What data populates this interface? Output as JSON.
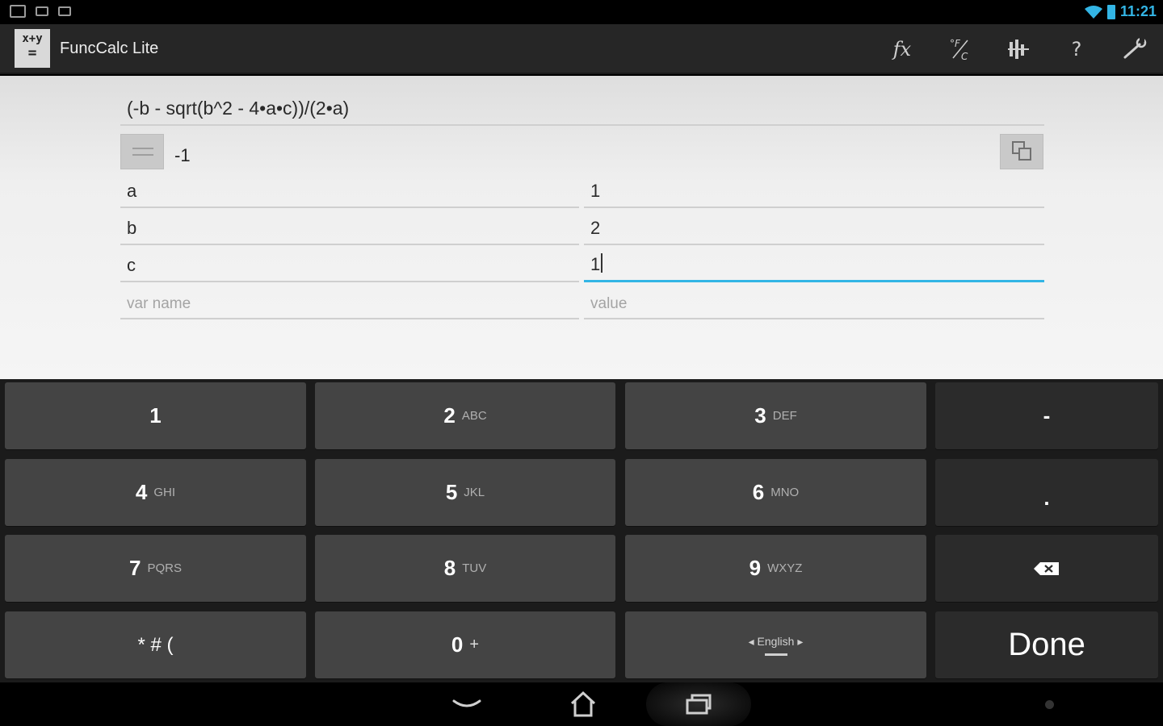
{
  "status_bar": {
    "time": "11:21",
    "icons": [
      "screenshot-icon",
      "chat-icon",
      "android-icon",
      "wifi-icon",
      "battery-icon"
    ]
  },
  "action_bar": {
    "logo_top": "x+y",
    "logo_bottom": "=",
    "title": "FuncCalc Lite",
    "actions": [
      {
        "name": "function-icon",
        "label": "fx"
      },
      {
        "name": "temperature-convert-icon",
        "label": "°F/C"
      },
      {
        "name": "scientific-icon",
        "label": ""
      },
      {
        "name": "help-icon",
        "label": "?"
      },
      {
        "name": "settings-wrench-icon",
        "label": ""
      }
    ]
  },
  "calculator": {
    "expression": "(-b - sqrt(b^2 - 4•a•c))/(2•a)",
    "result": "-1",
    "variables": [
      {
        "name": "a",
        "value": "1"
      },
      {
        "name": "b",
        "value": "2"
      },
      {
        "name": "c",
        "value": "1"
      }
    ],
    "new_var_placeholder": "var name",
    "new_value_placeholder": "value"
  },
  "keyboard": {
    "keys": [
      {
        "main": "1",
        "sub": ""
      },
      {
        "main": "2",
        "sub": "ABC"
      },
      {
        "main": "3",
        "sub": "DEF"
      },
      {
        "main": "-",
        "sub": ""
      },
      {
        "main": "4",
        "sub": "GHI"
      },
      {
        "main": "5",
        "sub": "JKL"
      },
      {
        "main": "6",
        "sub": "MNO"
      },
      {
        "main": ".",
        "sub": ""
      },
      {
        "main": "7",
        "sub": "PQRS"
      },
      {
        "main": "8",
        "sub": "TUV"
      },
      {
        "main": "9",
        "sub": "WXYZ"
      },
      {
        "main": "",
        "sub": ""
      },
      {
        "main": "* # (",
        "sub": ""
      },
      {
        "main": "0",
        "sub": "+"
      },
      {
        "main": "English",
        "sub": ""
      },
      {
        "main": "Done",
        "sub": ""
      }
    ]
  },
  "colors": {
    "accent": "#33b5e5",
    "key": "#444444",
    "key_dark": "#2b2b2b",
    "action_bar": "#262626"
  }
}
